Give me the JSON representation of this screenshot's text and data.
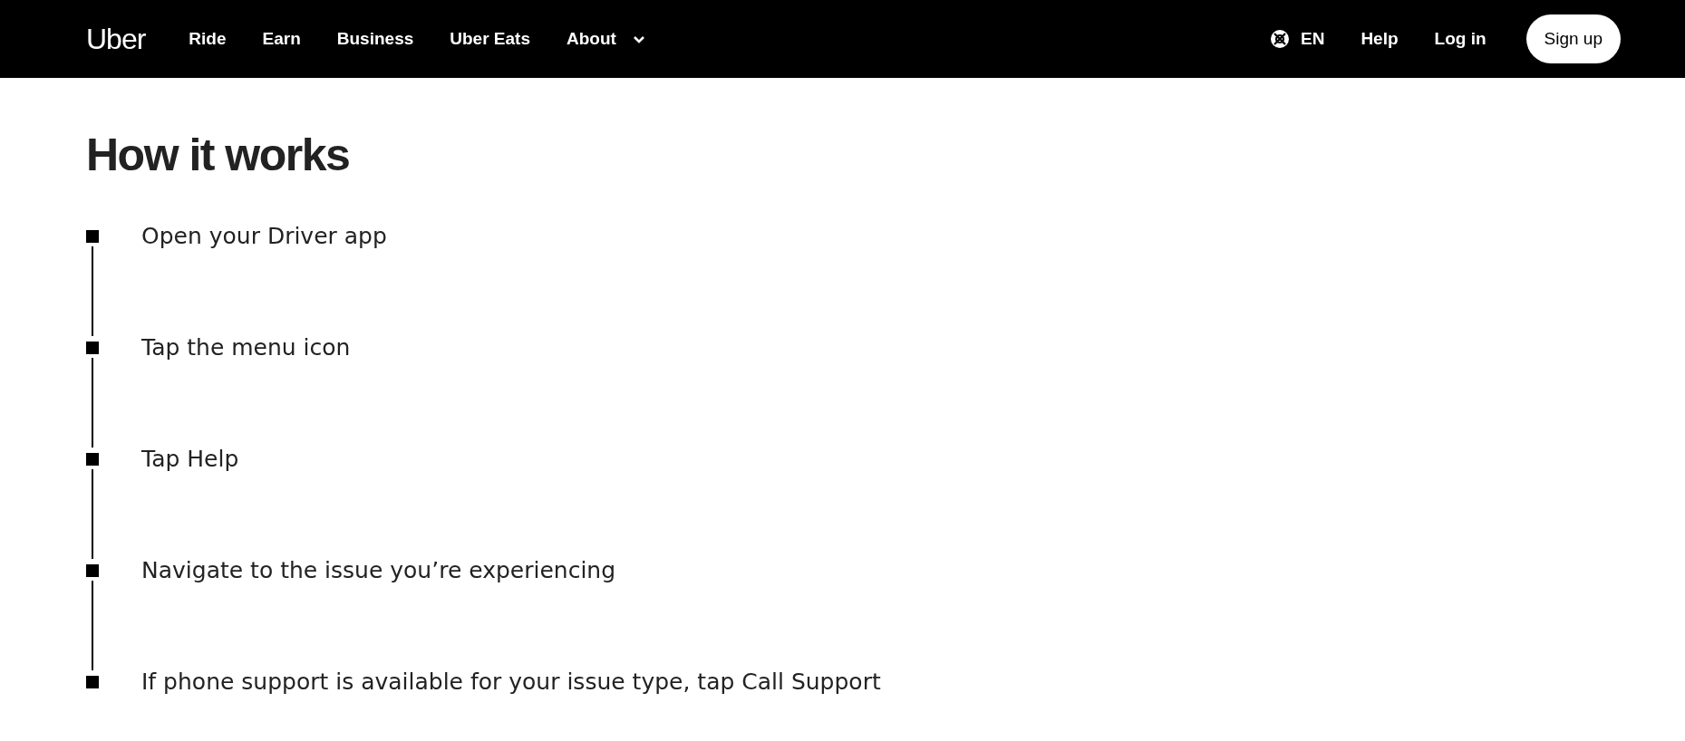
{
  "nav": {
    "logo": "Uber",
    "links": [
      "Ride",
      "Earn",
      "Business",
      "Uber Eats",
      "About"
    ],
    "language": "EN",
    "help": "Help",
    "login": "Log in",
    "signup": "Sign up"
  },
  "heading": "How it works",
  "steps": [
    "Open your Driver app",
    "Tap the menu icon",
    "Tap Help",
    "Navigate to the issue you’re experiencing",
    "If phone support is available for your issue type, tap Call Support"
  ]
}
